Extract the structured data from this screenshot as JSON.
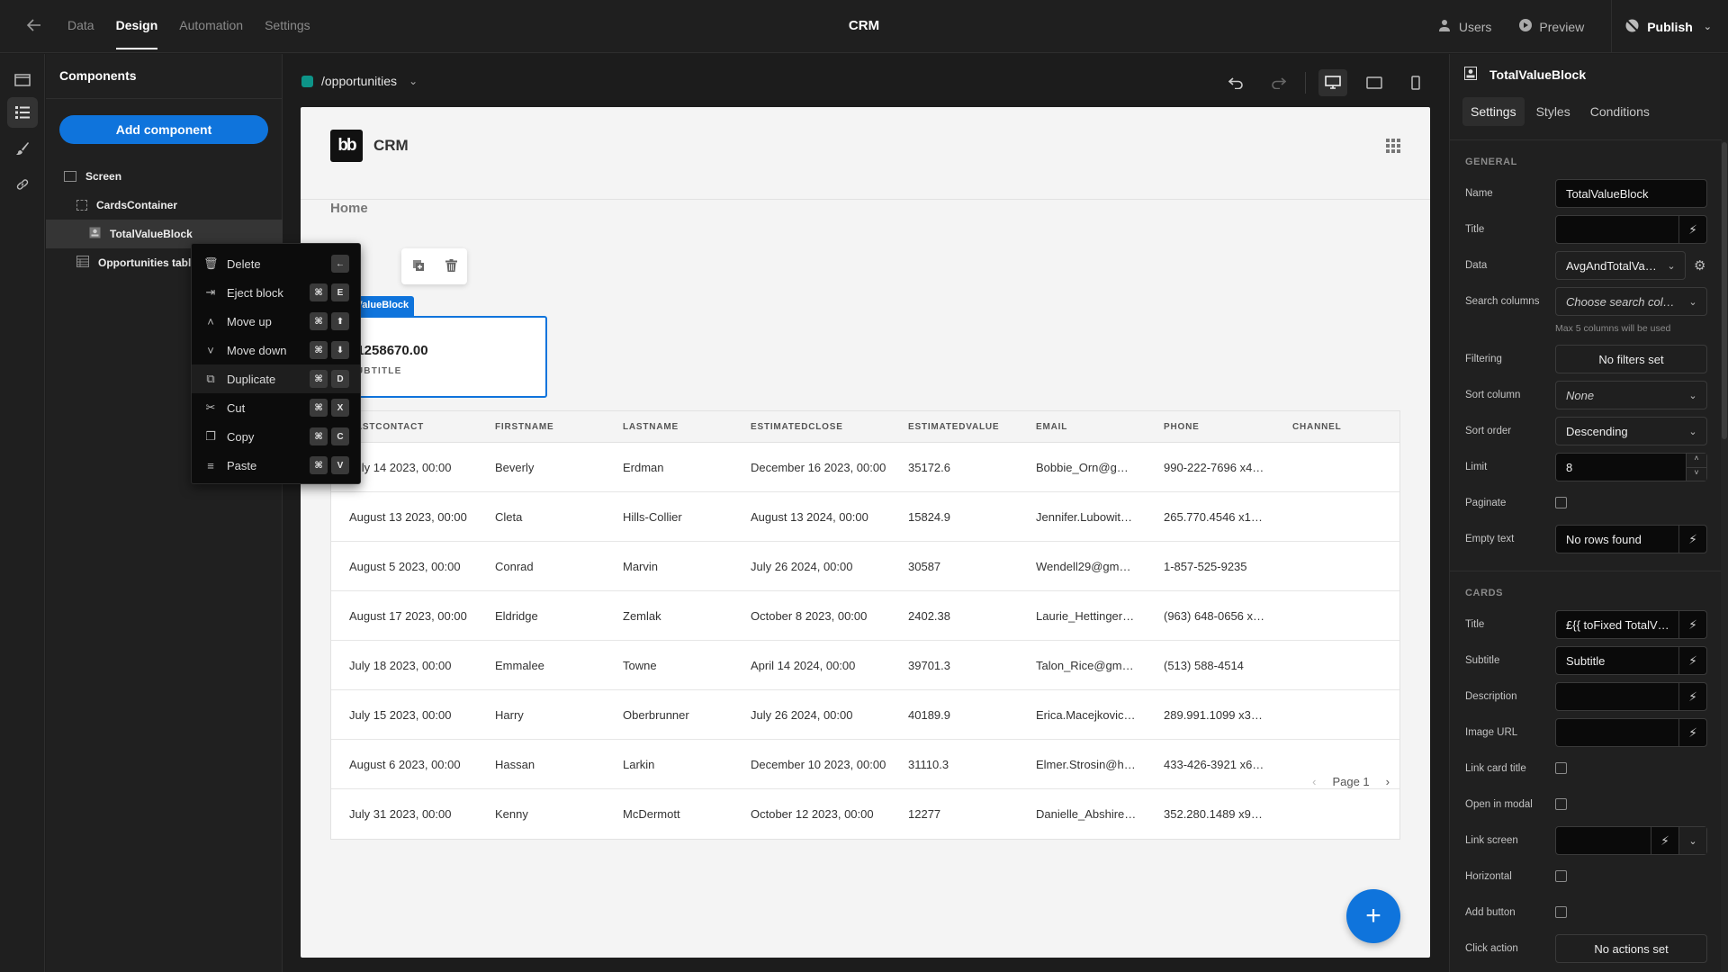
{
  "topbar": {
    "nav": [
      "Data",
      "Design",
      "Automation",
      "Settings"
    ],
    "active_nav": "Design",
    "app_title": "CRM",
    "users_label": "Users",
    "preview_label": "Preview",
    "publish_label": "Publish"
  },
  "components_panel": {
    "title": "Components",
    "add_button": "Add component",
    "tree": [
      {
        "label": "Screen",
        "icon": "screen-icon"
      },
      {
        "label": "CardsContainer",
        "icon": "container-icon"
      },
      {
        "label": "TotalValueBlock",
        "icon": "card-block-icon"
      },
      {
        "label": "Opportunities table",
        "icon": "table-icon"
      }
    ]
  },
  "context_menu": {
    "items": [
      {
        "label": "Delete",
        "keys": [
          "←"
        ]
      },
      {
        "label": "Eject block",
        "keys": [
          "⌘",
          "E"
        ]
      },
      {
        "label": "Move up",
        "keys": [
          "⌘",
          "⬆"
        ]
      },
      {
        "label": "Move down",
        "keys": [
          "⌘",
          "⬇"
        ]
      },
      {
        "label": "Duplicate",
        "keys": [
          "⌘",
          "D"
        ]
      },
      {
        "label": "Cut",
        "keys": [
          "⌘",
          "X"
        ]
      },
      {
        "label": "Copy",
        "keys": [
          "⌘",
          "C"
        ]
      },
      {
        "label": "Paste",
        "keys": [
          "⌘",
          "V"
        ]
      }
    ]
  },
  "canvas": {
    "route": "/opportunities",
    "route_color": "#0d9488",
    "app_name": "CRM",
    "logo_text": "bb",
    "nav_home": "Home",
    "block_tag": "TotalValueBlock",
    "card_value": "£1258670.00",
    "card_subtitle": "SUBTITLE",
    "table": {
      "columns": [
        "LASTCONTACT",
        "FIRSTNAME",
        "LASTNAME",
        "ESTIMATEDCLOSE",
        "ESTIMATEDVALUE",
        "EMAIL",
        "PHONE",
        "CHANNEL"
      ],
      "rows": [
        [
          "July 14 2023, 00:00",
          "Beverly",
          "Erdman",
          "December 16 2023, 00:00",
          "35172.6",
          "Bobbie_Orn@g…",
          "990-222-7696 x4…",
          ""
        ],
        [
          "August 13 2023, 00:00",
          "Cleta",
          "Hills-Collier",
          "August 13 2024, 00:00",
          "15824.9",
          "Jennifer.Lubowit…",
          "265.770.4546 x1…",
          ""
        ],
        [
          "August 5 2023, 00:00",
          "Conrad",
          "Marvin",
          "July 26 2024, 00:00",
          "30587",
          "Wendell29@gm…",
          "1-857-525-9235",
          ""
        ],
        [
          "August 17 2023, 00:00",
          "Eldridge",
          "Zemlak",
          "October 8 2023, 00:00",
          "2402.38",
          "Laurie_Hettinger…",
          "(963) 648-0656 x…",
          ""
        ],
        [
          "July 18 2023, 00:00",
          "Emmalee",
          "Towne",
          "April 14 2024, 00:00",
          "39701.3",
          "Talon_Rice@gm…",
          "(513) 588-4514",
          ""
        ],
        [
          "July 15 2023, 00:00",
          "Harry",
          "Oberbrunner",
          "July 26 2024, 00:00",
          "40189.9",
          "Erica.Macejkovic…",
          "289.991.1099 x3…",
          ""
        ],
        [
          "August 6 2023, 00:00",
          "Hassan",
          "Larkin",
          "December 10 2023, 00:00",
          "31110.3",
          "Elmer.Strosin@h…",
          "433-426-3921 x6…",
          ""
        ],
        [
          "July 31 2023, 00:00",
          "Kenny",
          "McDermott",
          "October 12 2023, 00:00",
          "12277",
          "Danielle_Abshire…",
          "352.280.1489 x9…",
          ""
        ]
      ]
    },
    "pager_label": "Page 1"
  },
  "settings_panel": {
    "component_name": "TotalValueBlock",
    "tabs": [
      "Settings",
      "Styles",
      "Conditions"
    ],
    "active_tab": "Settings",
    "general_heading": "GENERAL",
    "name_label": "Name",
    "name_value": "TotalValueBlock",
    "title_label": "Title",
    "title_value": "",
    "data_label": "Data",
    "data_value": "AvgAndTotalValue",
    "search_label": "Search columns",
    "search_placeholder": "Choose search col…",
    "search_hint": "Max 5 columns will be used",
    "filtering_label": "Filtering",
    "filtering_value": "No filters set",
    "sort_column_label": "Sort column",
    "sort_column_value": "None",
    "sort_order_label": "Sort order",
    "sort_order_value": "Descending",
    "limit_label": "Limit",
    "limit_value": "8",
    "paginate_label": "Paginate",
    "paginate_checked": false,
    "empty_text_label": "Empty text",
    "empty_text_value": "No rows found",
    "cards_heading": "CARDS",
    "card_title_label": "Title",
    "card_title_value": "£{{ toFixed TotalV…",
    "subtitle_label": "Subtitle",
    "subtitle_value": "Subtitle",
    "description_label": "Description",
    "description_value": "",
    "image_url_label": "Image URL",
    "image_url_value": "",
    "link_card_title_label": "Link card title",
    "link_card_title_checked": false,
    "open_in_modal_label": "Open in modal",
    "open_in_modal_checked": false,
    "link_screen_label": "Link screen",
    "link_screen_value": "",
    "horizontal_label": "Horizontal",
    "horizontal_checked": false,
    "add_button_label": "Add button",
    "add_button_checked": false,
    "click_action_label": "Click action",
    "click_action_value": "No actions set"
  },
  "colors": {
    "accent": "#0f74dc",
    "route": "#0d9488"
  }
}
